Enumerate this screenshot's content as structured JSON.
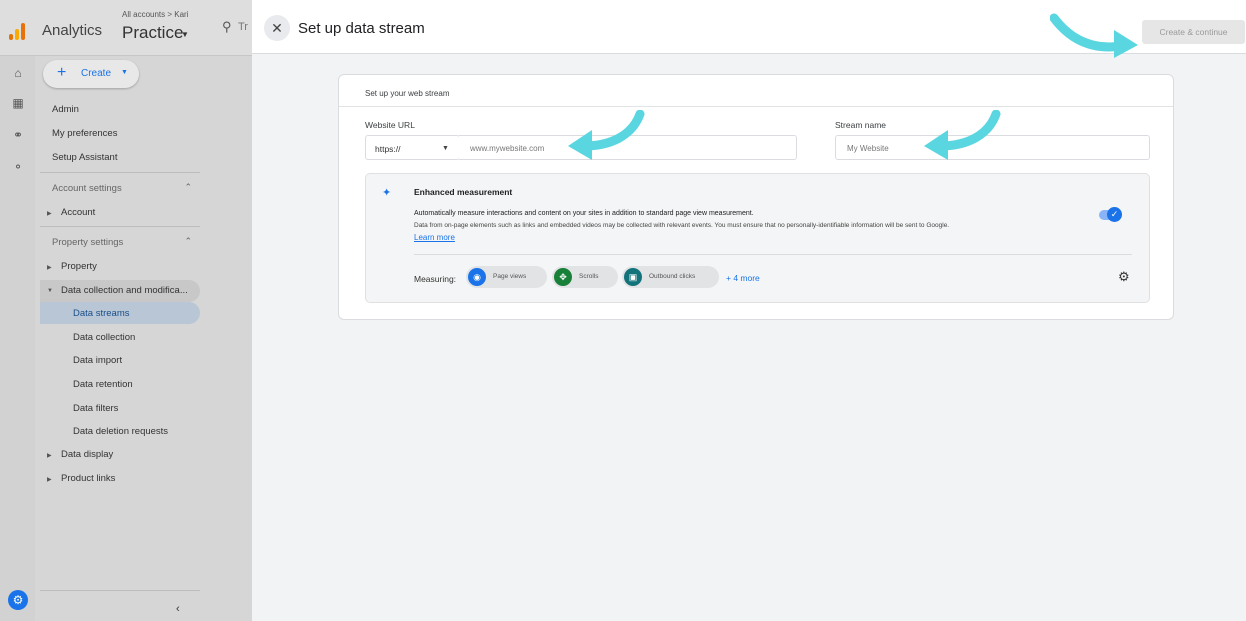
{
  "app": {
    "name": "Analytics",
    "breadcrumb": "All accounts > Kari",
    "property": "Practice",
    "search_hint": "Tr"
  },
  "sidebar": {
    "create_label": "Create",
    "top_items": [
      "Admin",
      "My preferences",
      "Setup Assistant"
    ],
    "account_section": "Account settings",
    "account_items": [
      "Account"
    ],
    "property_section": "Property settings",
    "property_items": [
      "Property",
      "Data collection and modifica..."
    ],
    "sub_items": [
      "Data streams",
      "Data collection",
      "Data import",
      "Data retention",
      "Data filters",
      "Data deletion requests"
    ],
    "bottom_items": [
      "Data display",
      "Product links"
    ],
    "active_item": "Data streams"
  },
  "panel": {
    "title": "Set up data stream",
    "primary_button": "Create & continue",
    "card_header": "Set up your web stream",
    "website_url_label": "Website URL",
    "protocol": "https://",
    "url_placeholder": "www.mywebsite.com",
    "stream_name_label": "Stream name",
    "stream_name_placeholder": "My Website",
    "enhanced": {
      "title": "Enhanced measurement",
      "description": "Automatically measure interactions and content on your sites in addition to standard page view measurement.",
      "note": "Data from on-page elements such as links and embedded videos may be collected with relevant events. You must ensure that no personally-identifiable information will be sent to Google.",
      "learn_more": "Learn more",
      "enabled": true,
      "measuring_label": "Measuring:",
      "chips": [
        {
          "label": "Page views",
          "icon": "eye-icon",
          "color": "#1a73e8"
        },
        {
          "label": "Scrolls",
          "icon": "move-arrows-icon",
          "color": "#188038"
        },
        {
          "label": "Outbound clicks",
          "icon": "mouse-pointer-icon",
          "color": "#12737b"
        }
      ],
      "more_link": "+ 4 more"
    }
  },
  "colors": {
    "accent": "#1a73e8",
    "annotation_arrow": "#5ad6e0"
  }
}
